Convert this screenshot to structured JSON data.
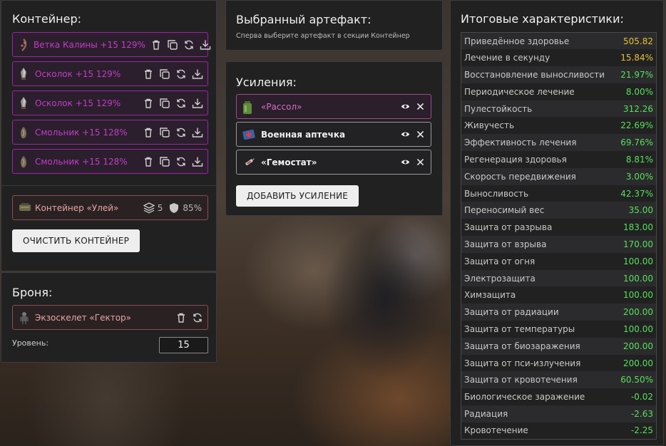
{
  "container": {
    "title": "Контейнер:",
    "artifacts": [
      {
        "name": "Ветка Калины +15 129%",
        "icon": "branch-artifact-icon"
      },
      {
        "name": "Осколок +15 129%",
        "icon": "shard-artifact-icon"
      },
      {
        "name": "Осколок +15 129%",
        "icon": "shard-artifact-icon"
      },
      {
        "name": "Смольник +15 128%",
        "icon": "resin-artifact-icon"
      },
      {
        "name": "Смольник +15 128%",
        "icon": "resin-artifact-icon"
      }
    ],
    "container_item": {
      "name": "Контейнер «Улей»",
      "slots": "5",
      "protection": "85%"
    },
    "clear_button": "ОЧИСТИТЬ КОНТЕЙНЕР"
  },
  "armor": {
    "title": "Броня:",
    "item_name": "Экзоскелет «Гектор»",
    "level_label": "Уровень:",
    "level_value": "15"
  },
  "selected": {
    "title": "Выбранный артефакт:",
    "hint": "Сперва выберите артефакт в секции Контейнер"
  },
  "boosts": {
    "title": "Усиления:",
    "items": [
      {
        "name": "«Рассол»",
        "active": true
      },
      {
        "name": "Военная аптечка",
        "active": false
      },
      {
        "name": "«Гемостат»",
        "active": false
      }
    ],
    "add_button": "ДОБАВИТЬ УСИЛЕНИЕ"
  },
  "stats": {
    "title": "Итоговые характеристики:",
    "colors": {
      "yellow": "#e6c232",
      "green": "#58e05a"
    },
    "rows": [
      {
        "label": "Приведённое здоровье",
        "value": "505.82",
        "color": "yellow"
      },
      {
        "label": "Лечение в секунду",
        "value": "15.84%",
        "color": "yellow"
      },
      {
        "label": "Восстановление выносливости",
        "value": "21.97%",
        "color": "green"
      },
      {
        "label": "Периодическое лечение",
        "value": "8.00%",
        "color": "green"
      },
      {
        "label": "Пулестойкость",
        "value": "312.26",
        "color": "green"
      },
      {
        "label": "Живучесть",
        "value": "22.69%",
        "color": "green"
      },
      {
        "label": "Эффективность лечения",
        "value": "69.76%",
        "color": "green"
      },
      {
        "label": "Регенерация здоровья",
        "value": "8.81%",
        "color": "green"
      },
      {
        "label": "Скорость передвижения",
        "value": "3.00%",
        "color": "green"
      },
      {
        "label": "Выносливость",
        "value": "42.37%",
        "color": "green"
      },
      {
        "label": "Переносимый вес",
        "value": "35.00",
        "color": "green"
      },
      {
        "label": "Защита от разрыва",
        "value": "183.00",
        "color": "green"
      },
      {
        "label": "Защита от взрыва",
        "value": "170.00",
        "color": "green"
      },
      {
        "label": "Защита от огня",
        "value": "100.00",
        "color": "green"
      },
      {
        "label": "Электрозащита",
        "value": "100.00",
        "color": "green"
      },
      {
        "label": "Химзащита",
        "value": "100.00",
        "color": "green"
      },
      {
        "label": "Защита от радиации",
        "value": "200.00",
        "color": "green"
      },
      {
        "label": "Защита от температуры",
        "value": "100.00",
        "color": "green"
      },
      {
        "label": "Защита от биозаражения",
        "value": "200.00",
        "color": "green"
      },
      {
        "label": "Защита от пси-излучения",
        "value": "200.00",
        "color": "green"
      },
      {
        "label": "Защита от кровотечения",
        "value": "60.50%",
        "color": "green"
      },
      {
        "label": "Биологическое заражение",
        "value": "-0.02",
        "color": "green"
      },
      {
        "label": "Радиация",
        "value": "-2.63",
        "color": "green"
      },
      {
        "label": "Кровотечение",
        "value": "-2.25",
        "color": "green"
      }
    ]
  }
}
